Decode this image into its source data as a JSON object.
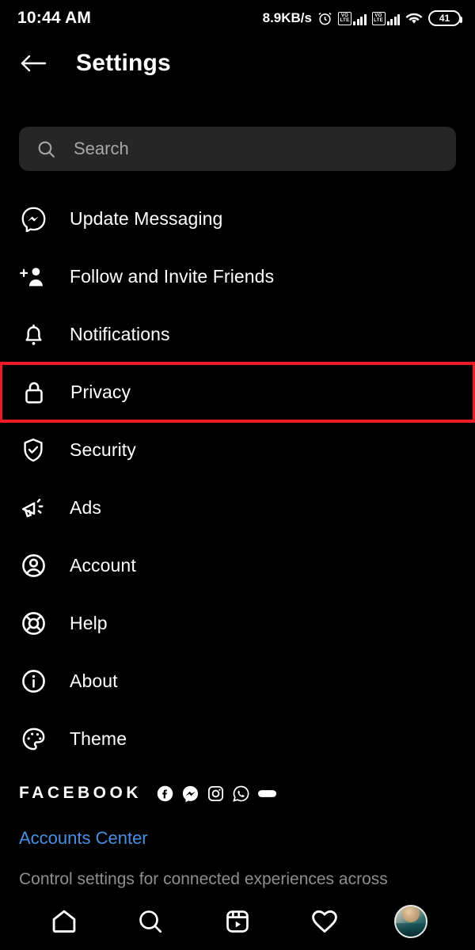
{
  "status_bar": {
    "time": "10:44 AM",
    "network_speed": "8.9KB/s",
    "alarm_icon": "alarm-clock-icon",
    "volte_label_top": "VO",
    "volte_label_bottom": "LTE",
    "wifi_icon": "wifi-icon",
    "battery_level": "41"
  },
  "header": {
    "back_icon": "back-arrow-icon",
    "title": "Settings"
  },
  "search": {
    "icon": "search-icon",
    "placeholder": "Search",
    "value": ""
  },
  "menu": {
    "items": [
      {
        "label": "Update Messaging",
        "icon": "messenger-icon",
        "highlighted": false
      },
      {
        "label": "Follow and Invite Friends",
        "icon": "person-plus-icon",
        "highlighted": false
      },
      {
        "label": "Notifications",
        "icon": "bell-icon",
        "highlighted": false
      },
      {
        "label": "Privacy",
        "icon": "lock-icon",
        "highlighted": true
      },
      {
        "label": "Security",
        "icon": "shield-check-icon",
        "highlighted": false
      },
      {
        "label": "Ads",
        "icon": "megaphone-icon",
        "highlighted": false
      },
      {
        "label": "Account",
        "icon": "person-circle-icon",
        "highlighted": false
      },
      {
        "label": "Help",
        "icon": "lifebuoy-icon",
        "highlighted": false
      },
      {
        "label": "About",
        "icon": "info-circle-icon",
        "highlighted": false
      },
      {
        "label": "Theme",
        "icon": "palette-icon",
        "highlighted": false
      }
    ]
  },
  "facebook_section": {
    "heading": "FACEBOOK",
    "brand_icons": [
      "facebook-icon",
      "messenger-icon",
      "instagram-icon",
      "whatsapp-icon",
      "oculus-icon"
    ],
    "accounts_center_link": "Accounts Center",
    "description": "Control settings for connected experiences across"
  },
  "bottom_nav": {
    "items": [
      {
        "name": "home-icon"
      },
      {
        "name": "search-icon"
      },
      {
        "name": "reels-icon"
      },
      {
        "name": "heart-icon"
      },
      {
        "name": "profile-avatar"
      }
    ]
  },
  "colors": {
    "background": "#000000",
    "search_background": "#262626",
    "highlight_red": "#ed1c24",
    "link_blue": "#4a90e2",
    "muted_text": "#8e8e8e"
  }
}
